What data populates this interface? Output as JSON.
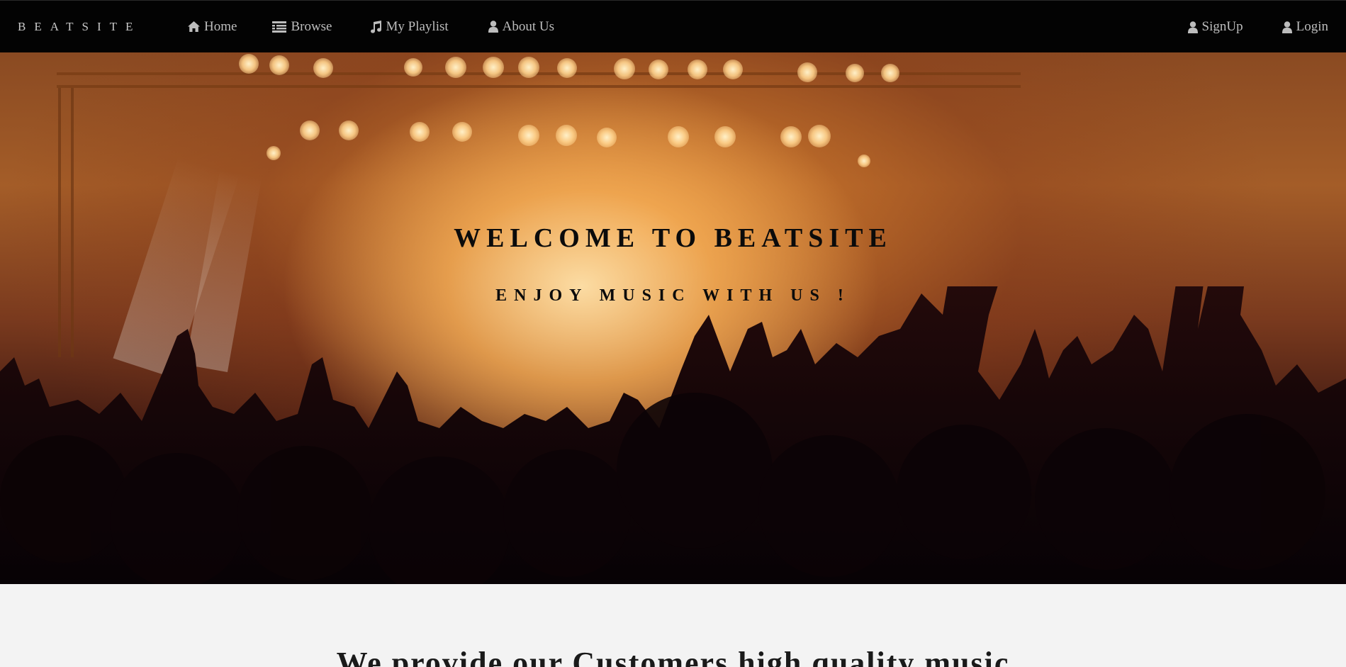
{
  "navbar": {
    "brand": "BEATSITE",
    "left_items": [
      {
        "label": "Home",
        "icon": "home-icon"
      },
      {
        "label": "Browse",
        "icon": "list-icon"
      },
      {
        "label": "My Playlist",
        "icon": "music-note-icon"
      },
      {
        "label": "About Us",
        "icon": "user-icon"
      }
    ],
    "right_items": [
      {
        "label": "SignUp",
        "icon": "user-icon"
      },
      {
        "label": "Login",
        "icon": "user-icon"
      }
    ]
  },
  "hero": {
    "title": "WELCOME TO BEATSITE",
    "subtitle": "ENJOY MUSIC WITH US !"
  },
  "section": {
    "heading": "We provide our Customers high quality music"
  },
  "colors": {
    "navbar_bg": "#030303",
    "nav_text": "#bdbdbd",
    "page_bg": "#f3f3f3",
    "hero_text": "#0b0b0b"
  }
}
